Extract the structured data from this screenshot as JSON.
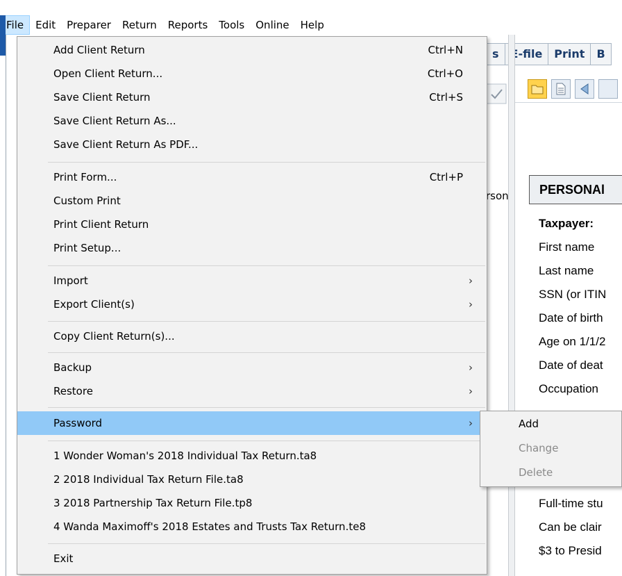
{
  "menubar": {
    "items": [
      "File",
      "Edit",
      "Preparer",
      "Return",
      "Reports",
      "Tools",
      "Online",
      "Help"
    ]
  },
  "background": {
    "tabs": [
      "s",
      "E-file",
      "Print",
      "B"
    ],
    "stray_text": "rson",
    "section_header": "PERSONAl",
    "form_lines": [
      "Taxpayer:",
      "First name",
      "Last name",
      "SSN (or ITIN",
      "Date of birth",
      "Age on 1/1/2",
      "Date of deat",
      "Occupation"
    ],
    "form_lines_lower": [
      "Full-time stu",
      "Can be clair",
      "$3 to Presid"
    ]
  },
  "file_menu": {
    "groups": [
      [
        {
          "label": "Add Client Return",
          "shortcut": "Ctrl+N"
        },
        {
          "label": "Open Client Return...",
          "shortcut": "Ctrl+O"
        },
        {
          "label": "Save Client Return",
          "shortcut": "Ctrl+S"
        },
        {
          "label": "Save Client Return As...",
          "shortcut": ""
        },
        {
          "label": "Save Client Return As PDF...",
          "shortcut": ""
        }
      ],
      [
        {
          "label": "Print Form...",
          "shortcut": "Ctrl+P"
        },
        {
          "label": "Custom Print",
          "shortcut": ""
        },
        {
          "label": "Print Client Return",
          "shortcut": ""
        },
        {
          "label": "Print Setup...",
          "shortcut": ""
        }
      ],
      [
        {
          "label": "Import",
          "submenu": true
        },
        {
          "label": "Export Client(s)",
          "submenu": true
        }
      ],
      [
        {
          "label": "Copy Client Return(s)..."
        }
      ],
      [
        {
          "label": "Backup",
          "submenu": true
        },
        {
          "label": "Restore",
          "submenu": true
        }
      ],
      [
        {
          "label": "Password",
          "submenu": true,
          "highlighted": true
        }
      ],
      [
        {
          "label": "1 Wonder Woman's 2018 Individual Tax Return.ta8"
        },
        {
          "label": "2 2018 Individual Tax Return File.ta8"
        },
        {
          "label": "3 2018 Partnership Tax Return File.tp8"
        },
        {
          "label": "4 Wanda Maximoff's 2018 Estates and Trusts Tax Return.te8"
        }
      ],
      [
        {
          "label": "Exit"
        }
      ]
    ],
    "submenu_arrow": "›"
  },
  "password_submenu": {
    "items": [
      {
        "label": "Add",
        "enabled": true
      },
      {
        "label": "Change",
        "enabled": false
      },
      {
        "label": "Delete",
        "enabled": false
      }
    ]
  },
  "colors": {
    "highlight": "#91c9f7",
    "menu_bg": "#f2f2f2",
    "disabled_text": "#8a8a8a",
    "accent": "#1e5aa8"
  }
}
